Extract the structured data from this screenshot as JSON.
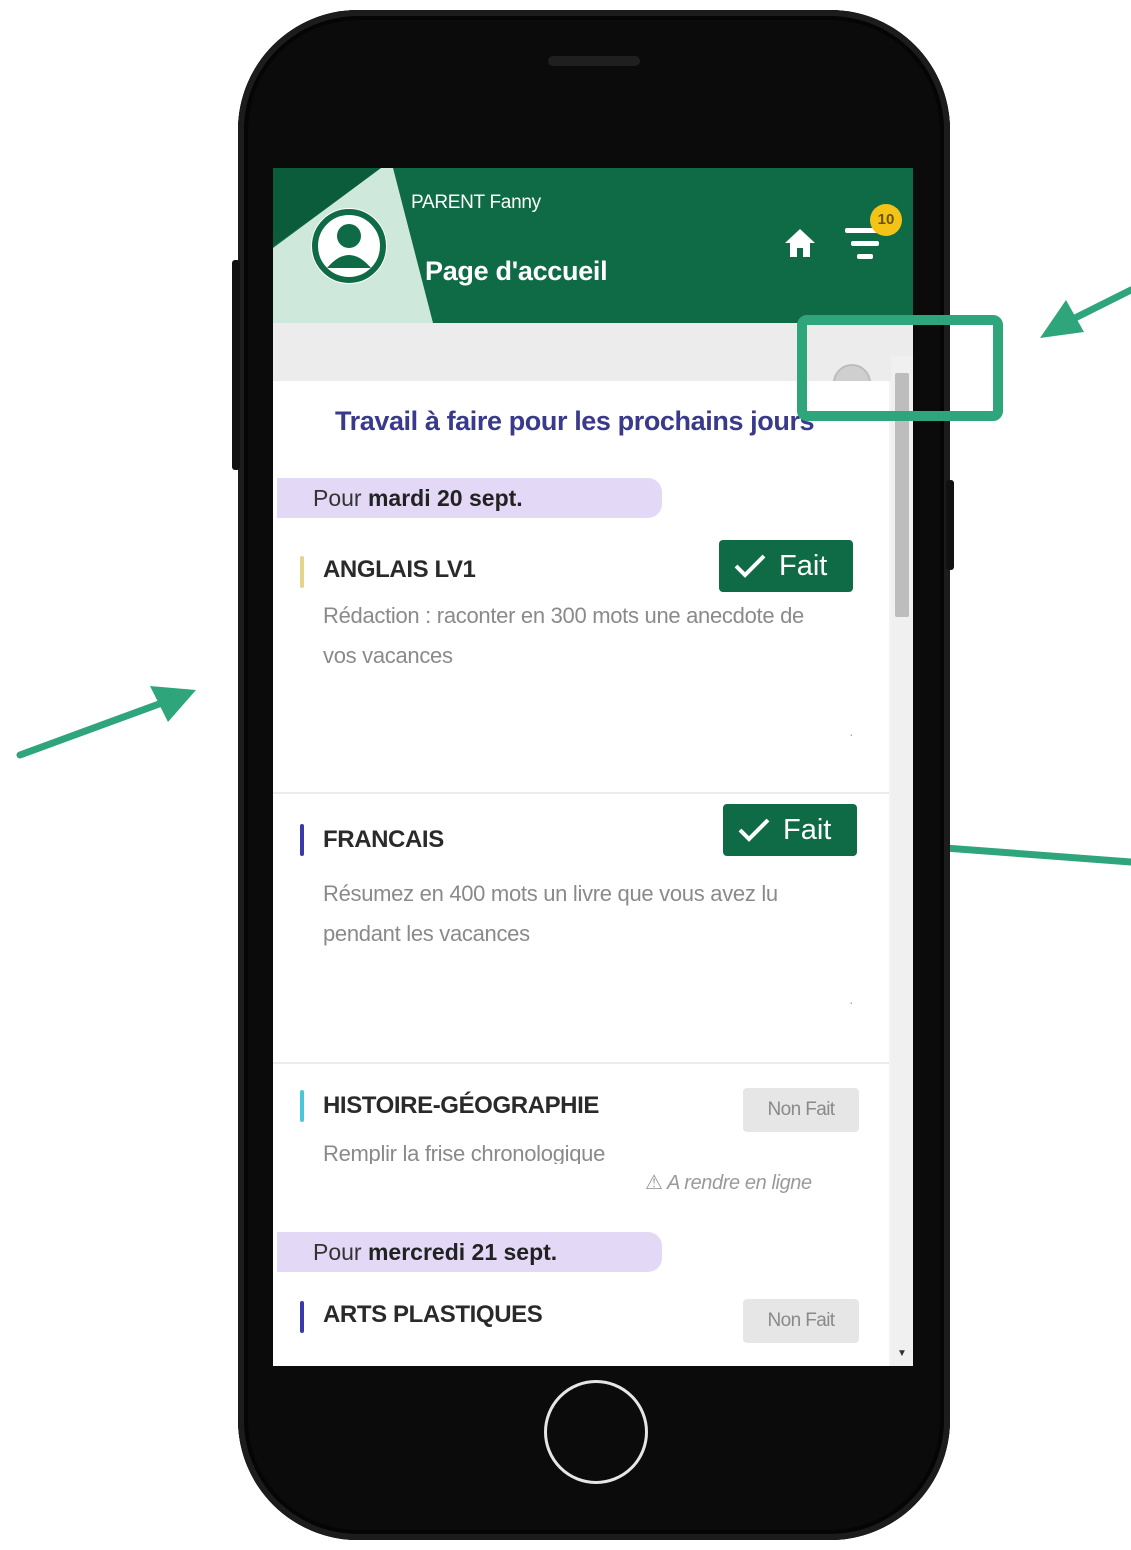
{
  "header": {
    "user_name": "PARENT Fanny",
    "page_title": "Page d'accueil",
    "notification_count": "10"
  },
  "section_title": "Travail à faire pour les prochains jours",
  "days": [
    {
      "prefix": "Pour",
      "date": "mardi 20 sept.",
      "items": [
        {
          "subject": "ANGLAIS LV1",
          "description": "Rédaction : raconter en 300 mots une anecdote de vos vacances",
          "status": "Fait",
          "subject_color": "#e5d58a"
        },
        {
          "subject": "FRANCAIS",
          "description": "Résumez en 400 mots un livre que vous avez lu pendant les vacances",
          "status": "Fait",
          "subject_color": "#3a3aa8"
        },
        {
          "subject": "HISTOIRE-GÉOGRAPHIE",
          "description": "Remplir la frise chronologique",
          "status": "Non Fait",
          "note": "A rendre en ligne",
          "subject_color": "#4cc7d9"
        }
      ]
    },
    {
      "prefix": "Pour",
      "date": "mercredi 21 sept.",
      "items": [
        {
          "subject": "ARTS PLASTIQUES",
          "status": "Non Fait",
          "subject_color": "#3a3aa8"
        }
      ]
    }
  ],
  "colors": {
    "brand_green": "#0f6b45",
    "annotation_green": "#2fa57b",
    "date_pill": "#e3d9f7",
    "badge_yellow": "#f3c315"
  },
  "icons": [
    "user-avatar-icon",
    "home-icon",
    "menu-icon",
    "globe-icon",
    "check-icon",
    "warning-icon"
  ]
}
